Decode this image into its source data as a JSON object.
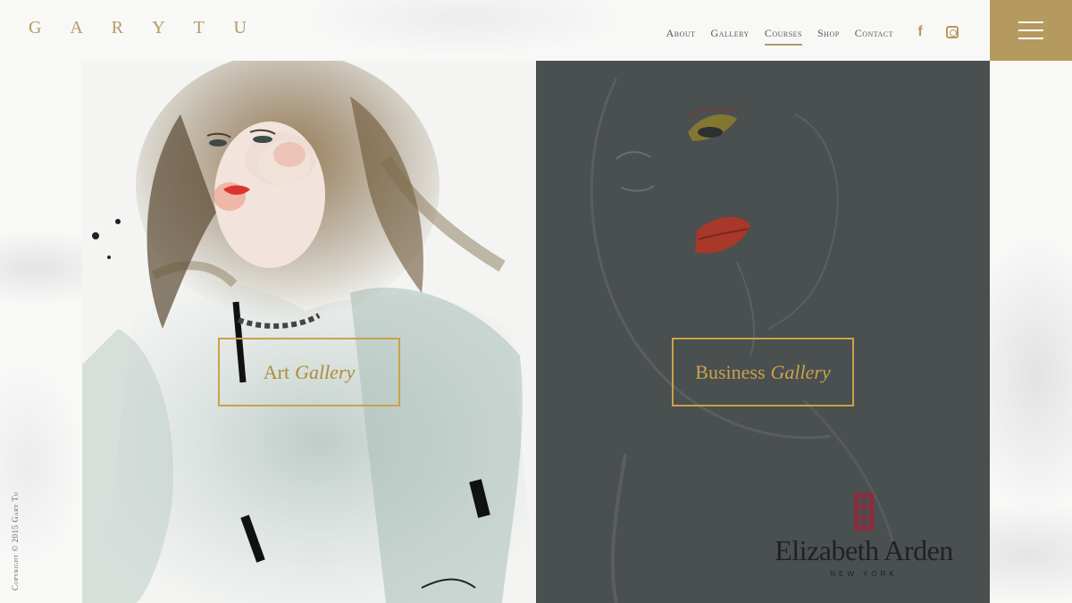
{
  "header": {
    "logo": "G A R Y T U",
    "nav": [
      {
        "label": "About",
        "active": false
      },
      {
        "label": "Gallery",
        "active": false
      },
      {
        "label": "Courses",
        "active": true
      },
      {
        "label": "Shop",
        "active": false
      },
      {
        "label": "Contact",
        "active": false
      }
    ],
    "social": {
      "facebook_glyph": "f",
      "icons": [
        "facebook-icon",
        "instagram-icon"
      ]
    },
    "menu_icon": "hamburger-menu-icon"
  },
  "panels": {
    "left": {
      "button_plain": "Art",
      "button_italic": "Gallery"
    },
    "right": {
      "button_plain": "Business",
      "button_italic": "Gallery",
      "brand_name": "Elizabeth Arden",
      "brand_sub": "NEW YORK"
    }
  },
  "footer": {
    "copyright": "Copyright © 2015 Gary Tu"
  },
  "colors": {
    "accent": "#b49a5f",
    "button_border": "#c9a24a",
    "dark_panel": "#4a4f50",
    "brand_red": "#8c2c3c"
  }
}
